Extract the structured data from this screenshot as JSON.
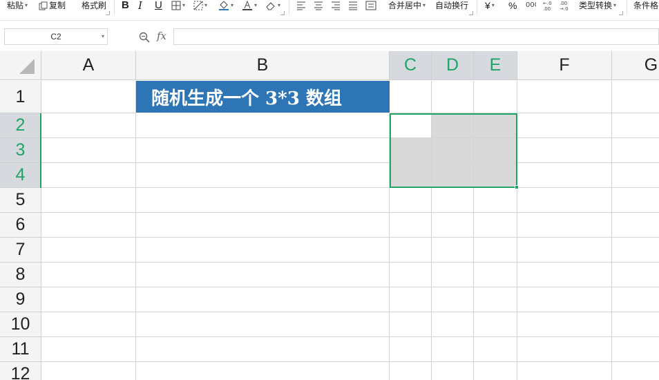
{
  "ribbon": {
    "paste": "粘贴",
    "copy": "复制",
    "format_painter": "格式刷",
    "bold": "B",
    "italic": "I",
    "underline": "U",
    "merge_center": "合并居中",
    "wrap_text": "自动换行",
    "currency": "¥",
    "percent": "%",
    "type_convert": "类型转换",
    "conditional_format": "条件格式"
  },
  "formula_bar": {
    "name_box": "C2",
    "fx": "fx",
    "formula": ""
  },
  "columns": [
    "A",
    "B",
    "C",
    "D",
    "E",
    "F",
    "G"
  ],
  "rows": [
    "1",
    "2",
    "3",
    "4",
    "5",
    "6",
    "7",
    "8",
    "9",
    "10",
    "11",
    "12"
  ],
  "cells": {
    "B1": "随机生成一个 3*3 数组"
  },
  "colors": {
    "title_fill": "#2e75b6",
    "title_text": "#ffffff",
    "selection": "#21a366",
    "selected_header": "#d6d9de",
    "shaded_cell": "#d9d9d9"
  }
}
